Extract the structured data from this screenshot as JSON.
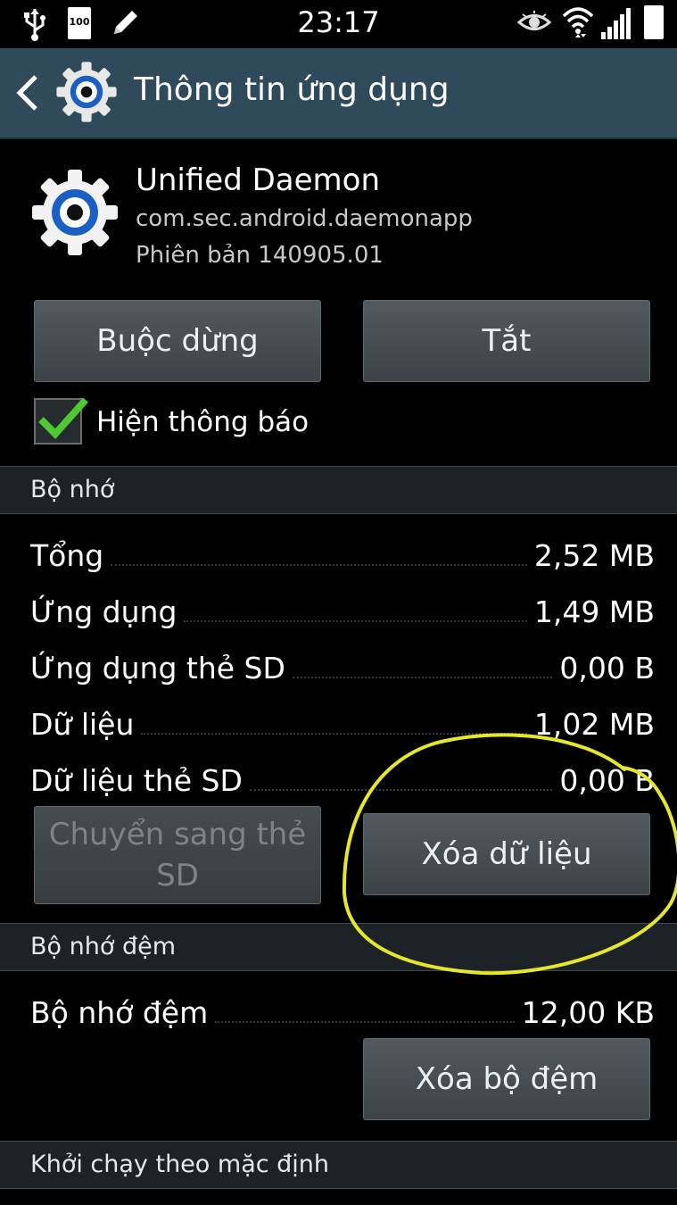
{
  "status_bar": {
    "time": "23:17",
    "battery_text": "100",
    "left_icons": [
      "usb-icon",
      "battery-icon",
      "pencil-icon"
    ],
    "right_icons": [
      "eye-icon",
      "wifi-icon",
      "signal-icon",
      "battery-icon"
    ]
  },
  "action_bar": {
    "title": "Thông tin ứng dụng"
  },
  "app": {
    "name": "Unified Daemon",
    "package": "com.sec.android.daemonapp",
    "version": "Phiên bản 140905.01"
  },
  "buttons": {
    "force_stop": "Buộc dừng",
    "disable": "Tắt",
    "move_to_sd": "Chuyển sang thẻ SD",
    "clear_data": "Xóa dữ liệu",
    "clear_cache": "Xóa bộ đệm"
  },
  "notifications": {
    "label": "Hiện thông báo",
    "checked": true
  },
  "storage": {
    "header": "Bộ nhớ",
    "rows": [
      {
        "label": "Tổng",
        "value": "2,52 MB"
      },
      {
        "label": "Ứng dụng",
        "value": "1,49 MB"
      },
      {
        "label": "Ứng dụng thẻ SD",
        "value": "0,00 B"
      },
      {
        "label": "Dữ liệu",
        "value": "1,02 MB"
      },
      {
        "label": "Dữ liệu thẻ SD",
        "value": "0,00 B"
      }
    ]
  },
  "cache": {
    "header": "Bộ nhớ đệm",
    "row": {
      "label": "Bộ nhớ đệm",
      "value": "12,00 KB"
    }
  },
  "launch_default": {
    "header": "Khởi chạy theo mặc định"
  },
  "colors": {
    "action_bar": "#2f4a5a",
    "accent_icon_blue": "#1a5fc4",
    "checkmark": "#4fc832",
    "annotation_circle": "#e6e62a"
  }
}
